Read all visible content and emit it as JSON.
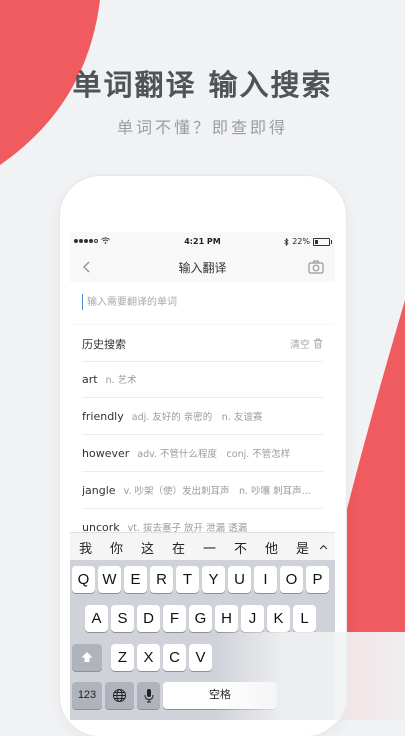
{
  "promo": {
    "headline": "单词翻译 输入搜索",
    "subline": "单词不懂？即查即得",
    "accent_color": "#ef5b5e"
  },
  "status_bar": {
    "time": "4:21 PM",
    "battery": "22%",
    "battery_level": 0.22,
    "signal_icon": "signal-dots-icon",
    "wifi_icon": "wifi-icon",
    "bluetooth_icon": "bluetooth-icon"
  },
  "nav": {
    "title": "输入翻译",
    "back_icon": "chevron-left-icon",
    "camera_icon": "camera-icon"
  },
  "search": {
    "placeholder": "输入需要翻译的单词"
  },
  "history": {
    "title": "历史搜索",
    "clear_label": "清空",
    "items": [
      {
        "word": "art",
        "def": "n. 艺术"
      },
      {
        "word": "friendly",
        "def": "adj. 友好的 亲密的　n. 友谊赛"
      },
      {
        "word": "however",
        "def": "adv. 不管什么程度　conj. 不管怎样"
      },
      {
        "word": "jangle",
        "def": "v. 吵架（使）发出刺耳声　n. 吵嚷 刺耳声..."
      },
      {
        "word": "uncork",
        "def": "vt. 拔去塞子 放开 泄漏 透漏"
      }
    ]
  },
  "keyboard": {
    "candidates": [
      "我",
      "你",
      "这",
      "在",
      "一",
      "不",
      "他",
      "是"
    ],
    "row1": [
      "Q",
      "W",
      "E",
      "R",
      "T",
      "Y",
      "U",
      "I",
      "O",
      "P"
    ],
    "row2": [
      "A",
      "S",
      "D",
      "F",
      "G",
      "H",
      "J",
      "K",
      "L"
    ],
    "row3": [
      "Z",
      "X",
      "C",
      "V"
    ],
    "numbers_key": "123",
    "space_key": "空格"
  }
}
